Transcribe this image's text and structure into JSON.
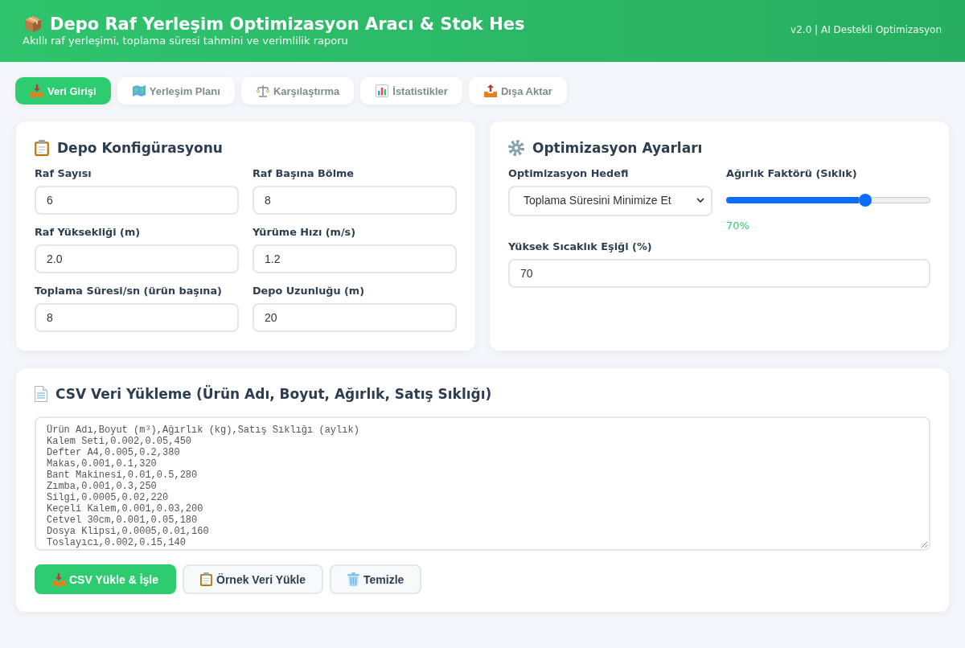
{
  "header": {
    "title": "Depo Raf Yerleşim Optimizasyon Aracı & Stok Hes",
    "subtitle": "Akıllı raf yerleşimi, toplama süresi tahmini ve verimlilik raporu",
    "version": "v2.0 | AI Destekli Optimizasyon"
  },
  "tabs": [
    {
      "label": "Veri Girişi",
      "selected": true
    },
    {
      "label": "Yerleşim Planı",
      "selected": false
    },
    {
      "label": "Karşılaştırma",
      "selected": false
    },
    {
      "label": "İstatistikler",
      "selected": false
    },
    {
      "label": "Dışa Aktar",
      "selected": false
    }
  ],
  "config_panel": {
    "title": "Depo Konfigürasyonu",
    "fields": [
      {
        "label": "Raf Sayısı",
        "value": "6"
      },
      {
        "label": "Raf Başına Bölme",
        "value": "8"
      },
      {
        "label": "Raf Yüksekliği (m)",
        "value": "2.0"
      },
      {
        "label": "Yürüme Hızı (m/s)",
        "value": "1.2"
      },
      {
        "label": "Toplama Süresi/sn (ürün başına)",
        "value": "8"
      },
      {
        "label": "Depo Uzunluğu (m)",
        "value": "20"
      }
    ]
  },
  "optimization_panel": {
    "title": "Optimizasyon Ayarları",
    "goal": {
      "label": "Optimizasyon Hedefi",
      "value": "Toplama Süresini Minimize Et"
    },
    "weight": {
      "label": "Ağırlık Faktörü (Sıklık)",
      "level": 0.7,
      "reading": "70%"
    },
    "threshold": {
      "label": "Yüksek Sıcaklık Eşiği (%)",
      "value": "70"
    }
  },
  "csv_panel": {
    "title": "CSV Veri Yükleme (Ürün Adı, Boyut, Ağırlık, Satış Sıklığı)",
    "value": "Ürün Adı,Boyut (m³),Ağırlık (kg),Satış Sıklığı (aylık)\nKalem Seti,0.002,0.05,450\nDefter A4,0.005,0.2,380\nMakas,0.001,0.1,320\nBant Makinesi,0.01,0.5,280\nZımba,0.001,0.3,250\nSilgi,0.0005,0.02,220\nKeçeli Kalem,0.001,0.03,200\nCetvel 30cm,0.001,0.05,180\nDosya Klipsi,0.0005,0.01,160\nToslayıcı,0.002,0.15,140",
    "buttons": [
      {
        "label": "CSV Yükle & İşle",
        "kind": "primary"
      },
      {
        "label": "Örnek Veri Yükle",
        "kind": "secondary"
      },
      {
        "label": "Temizle",
        "kind": "secondary"
      }
    ]
  }
}
